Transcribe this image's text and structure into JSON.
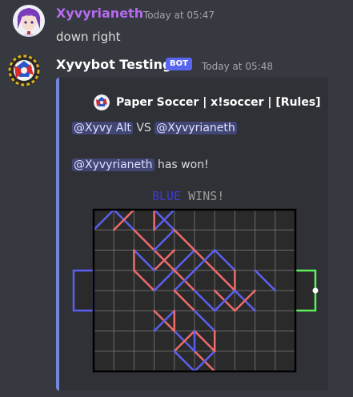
{
  "messages": [
    {
      "username": "Xyvyrianeth",
      "timestamp": "Today at 05:47",
      "text": "down right"
    },
    {
      "username": "Xyvybot Testing",
      "bot_tag": "BOT",
      "timestamp": "Today at 05:48",
      "embed": {
        "title": "Paper Soccer | x!soccer | [Rules]",
        "line1": {
          "mention_a": "@Xyvy Alt",
          "vs": "VS",
          "mention_b": "@Xyvyrianeth"
        },
        "line2": {
          "mention": "@Xyvyrianeth",
          "text": "has won!"
        },
        "banner": {
          "winner": "BLUE",
          "suffix": "WINS!"
        }
      }
    }
  ],
  "colors": {
    "username1": "#b66bf0",
    "blue_player": "#5b5ff0",
    "red_player": "#f06b6b",
    "goal_right": "#5cf05c"
  },
  "icons": [
    "avatar-anime-girl-icon",
    "avatar-soccer-ball-icon",
    "embed-soccer-ball-icon"
  ]
}
